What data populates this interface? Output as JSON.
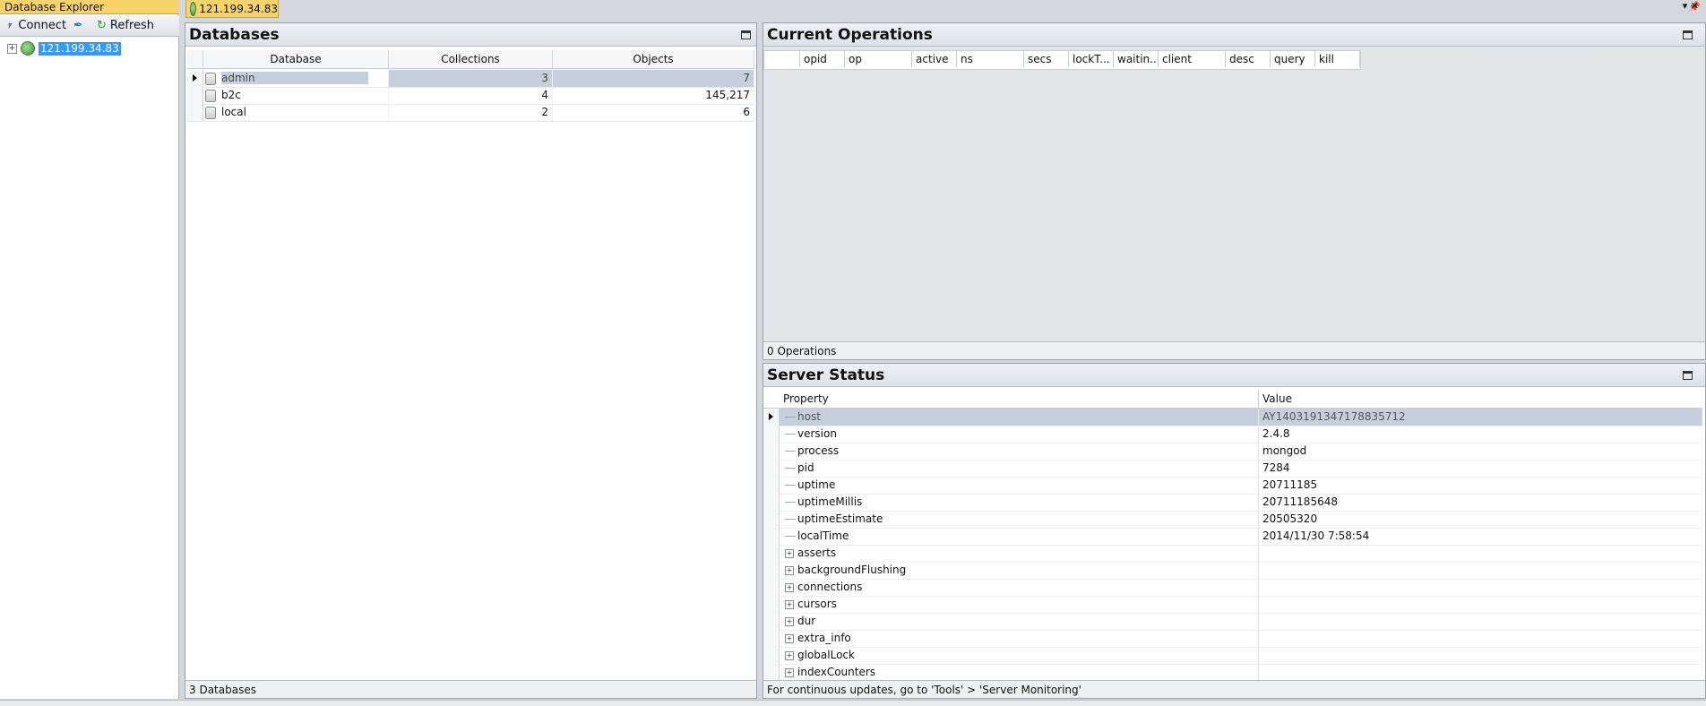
{
  "explorer": {
    "title": "Database Explorer",
    "toolbar": {
      "connect_label": "Connect",
      "refresh_label": "Refresh"
    },
    "tree": {
      "server": "121.199.34.83"
    }
  },
  "document_tab": {
    "label": "121.199.34.83"
  },
  "databases_panel": {
    "title": "Databases",
    "columns": [
      "Database",
      "Collections",
      "Objects"
    ],
    "rows": [
      {
        "name": "admin",
        "collections": "3",
        "objects": "7"
      },
      {
        "name": "b2c",
        "collections": "4",
        "objects": "145,217"
      },
      {
        "name": "local",
        "collections": "2",
        "objects": "6"
      }
    ],
    "footer": "3 Databases"
  },
  "current_operations_panel": {
    "title": "Current Operations",
    "columns": [
      "opid",
      "op",
      "active",
      "ns",
      "secs",
      "lockT...",
      "waitin...",
      "client",
      "desc",
      "query",
      "kill"
    ],
    "footer": "0 Operations"
  },
  "server_status_panel": {
    "title": "Server Status",
    "columns": [
      "Property",
      "Value"
    ],
    "rows": [
      {
        "property": "host",
        "value": "AY1403191347178835712"
      },
      {
        "property": "version",
        "value": "2.4.8"
      },
      {
        "property": "process",
        "value": "mongod"
      },
      {
        "property": "pid",
        "value": "7284"
      },
      {
        "property": "uptime",
        "value": "20711185"
      },
      {
        "property": "uptimeMillis",
        "value": "20711185648"
      },
      {
        "property": "uptimeEstimate",
        "value": "20505320"
      },
      {
        "property": "localTime",
        "value": "2014/11/30 7:58:54"
      },
      {
        "property": "asserts",
        "value": ""
      },
      {
        "property": "backgroundFlushing",
        "value": ""
      },
      {
        "property": "connections",
        "value": ""
      },
      {
        "property": "cursors",
        "value": ""
      },
      {
        "property": "dur",
        "value": ""
      },
      {
        "property": "extra_info",
        "value": ""
      },
      {
        "property": "globalLock",
        "value": ""
      },
      {
        "property": "indexCounters",
        "value": ""
      }
    ],
    "footer": "For continuous updates, go to 'Tools' > 'Server Monitoring'"
  }
}
